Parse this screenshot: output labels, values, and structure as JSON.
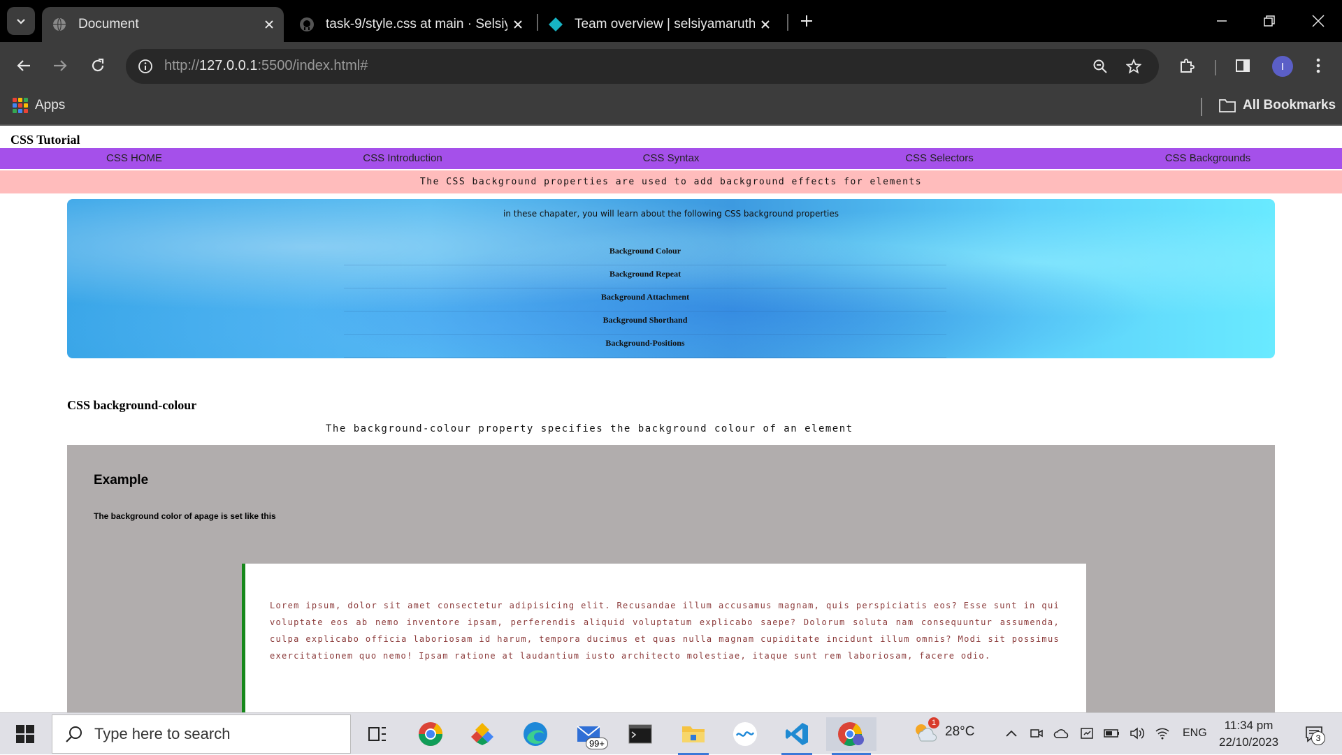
{
  "browser": {
    "tabs": [
      {
        "title": "Document",
        "active": true
      },
      {
        "title": "task-9/style.css at main · Selsiy",
        "active": false
      },
      {
        "title": "Team overview | selsiyamaruth",
        "active": false
      }
    ],
    "url": {
      "scheme": "http://",
      "host": "127.0.0.1",
      "rest": ":5500/index.html#"
    },
    "bookmarks": {
      "apps": "Apps",
      "all": "All Bookmarks"
    },
    "profile_initial": "I"
  },
  "page": {
    "site_title": "CSS Tutorial",
    "nav": [
      "CSS HOME",
      "CSS Introduction",
      "CSS Syntax",
      "CSS Selectors",
      "CSS Backgrounds"
    ],
    "banner": "The CSS background properties are used to add background effects for elements",
    "hero_intro": "in these chapater, you will learn about the following CSS background properties",
    "hero_list": [
      "Background Colour",
      "Background Repeat",
      "Background Attachment",
      "Background Shorthand",
      "Background-Positions"
    ],
    "section_title": "CSS background-colour",
    "section_desc": "The background-colour property specifies the background colour of an element",
    "example_title": "Example",
    "example_text": "The background color of apage is set like this",
    "quote": "Lorem ipsum, dolor sit amet consectetur adipisicing elit. Recusandae illum accusamus magnam, quis perspiciatis eos? Esse sunt in qui voluptate eos ab nemo inventore ipsam, perferendis aliquid voluptatum explicabo saepe? Dolorum soluta nam consequuntur assumenda, culpa explicabo officia laboriosam id harum, tempora ducimus et quas nulla magnam cupiditate incidunt illum omnis? Modi sit possimus exercitationem quo nemo! Ipsam ratione at laudantium iusto architecto molestiae, itaque sunt rem laboriosam, facere odio."
  },
  "taskbar": {
    "search_placeholder": "Type here to search",
    "mail_badge": "99+",
    "weather_temp": "28°C",
    "weather_alert": "1",
    "language": "ENG",
    "time": "11:34 pm",
    "date": "22/10/2023",
    "notification_count": "3"
  },
  "colors": {
    "nav": "#a550ea",
    "banner": "#ffbcbc",
    "example_bg": "#b1adad",
    "quote_border": "#16881b",
    "quote_text": "#8b3a3a"
  }
}
